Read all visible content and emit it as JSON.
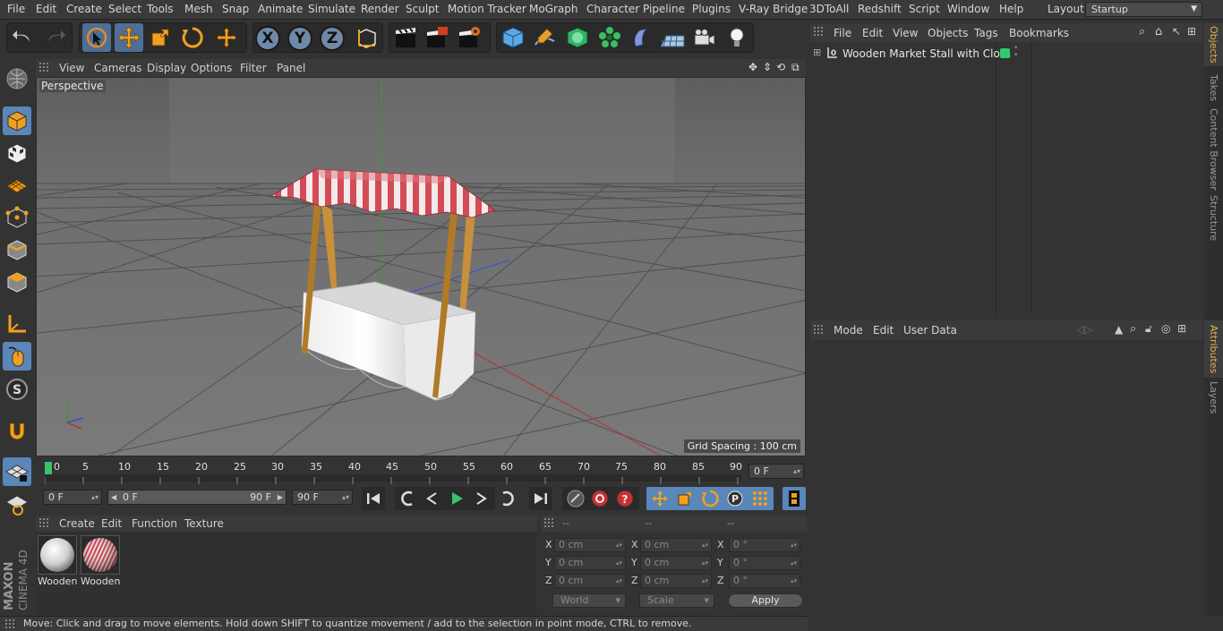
{
  "menubar": {
    "items": [
      "File",
      "Edit",
      "Create",
      "Select",
      "Tools",
      "Mesh",
      "Snap",
      "Animate",
      "Simulate",
      "Render",
      "Sculpt",
      "Motion Tracker",
      "MoGraph",
      "Character",
      "Pipeline",
      "Plugins",
      "V-Ray Bridge",
      "3DToAll",
      "Redshift",
      "Script",
      "Window",
      "Help"
    ],
    "layout_label": "Layout:",
    "layout_value": "Startup"
  },
  "viewport": {
    "menu": [
      "View",
      "Cameras",
      "Display",
      "Options",
      "Filter",
      "Panel"
    ],
    "label": "Perspective",
    "grid_spacing": "Grid Spacing : 100 cm"
  },
  "timeline": {
    "ticks": [
      "0",
      "5",
      "10",
      "15",
      "20",
      "25",
      "30",
      "35",
      "40",
      "45",
      "50",
      "55",
      "60",
      "65",
      "70",
      "75",
      "80",
      "85",
      "90"
    ],
    "current_frame": "0 F",
    "start_field": "0 F",
    "range_start": "0 F",
    "range_end": "90 F",
    "end_field": "90 F"
  },
  "materials": {
    "menu": [
      "Create",
      "Edit",
      "Function",
      "Texture"
    ],
    "items": [
      {
        "name": "Wooden",
        "type": "white"
      },
      {
        "name": "Wooden",
        "type": "striped"
      }
    ]
  },
  "coordinates": {
    "headers": [
      "--",
      "--",
      "--"
    ],
    "rows": [
      {
        "axis": "X",
        "pos": "0 cm",
        "size_axis": "X",
        "size": "0 cm",
        "rot_axis": "X",
        "rot": "0 °"
      },
      {
        "axis": "Y",
        "pos": "0 cm",
        "size_axis": "Y",
        "size": "0 cm",
        "rot_axis": "Y",
        "rot": "0 °"
      },
      {
        "axis": "Z",
        "pos": "0 cm",
        "size_axis": "Z",
        "size": "0 cm",
        "rot_axis": "Z",
        "rot": "0 °"
      }
    ],
    "space": "World",
    "mode": "Scale",
    "apply_label": "Apply"
  },
  "status_text": "Move: Click and drag to move elements. Hold down SHIFT to quantize movement / add to the selection in point mode, CTRL to remove.",
  "object_manager": {
    "menu": [
      "File",
      "Edit",
      "View",
      "Objects",
      "Tags",
      "Bookmarks"
    ],
    "object_name": "Wooden Market Stall with Cloth",
    "layer_color": "#2ecc71"
  },
  "attributes": {
    "menu": [
      "Mode",
      "Edit",
      "User Data"
    ]
  },
  "right_tabs": [
    "Objects",
    "Takes",
    "Content Browser",
    "Structure",
    "Attributes",
    "Layers"
  ],
  "logo": {
    "brand": "MAXON",
    "product": "CINEMA 4D"
  },
  "colors": {
    "accent": "#e6b04a",
    "active_tool": "#5a86b8",
    "axis_x": "#d03030",
    "axis_y": "#30a030",
    "axis_z": "#3050d0"
  }
}
